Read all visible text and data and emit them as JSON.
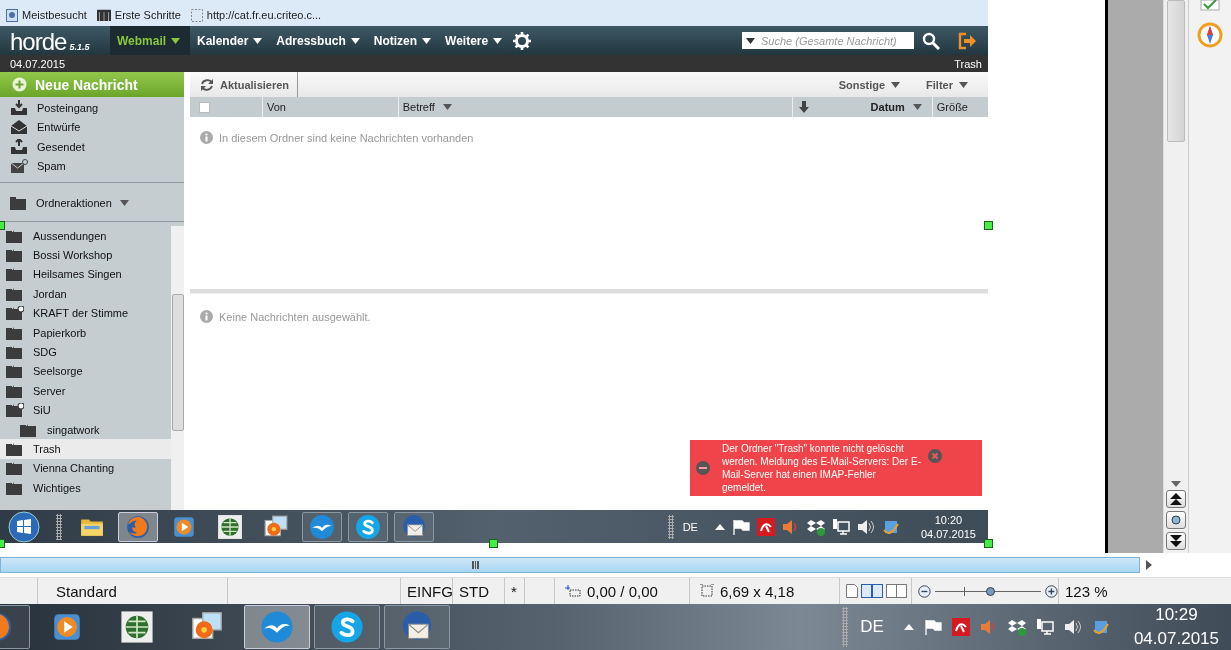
{
  "browser_bookmarks": [
    {
      "label": "Meistbesucht",
      "kind": "page"
    },
    {
      "label": "Erste Schritte",
      "kind": "m"
    },
    {
      "label": "http://cat.fr.eu.criteo.c...",
      "kind": "blank"
    }
  ],
  "app_header": {
    "logo": "horde",
    "version": "5.1.5",
    "menu": [
      {
        "label": "Webmail",
        "selected": true
      },
      {
        "label": "Kalender",
        "selected": false
      },
      {
        "label": "Adressbuch",
        "selected": false
      },
      {
        "label": "Notizen",
        "selected": false
      },
      {
        "label": "Weitere",
        "selected": false
      }
    ],
    "search": {
      "placeholder": "Suche (Gesamte Nachricht)"
    }
  },
  "date_bar": {
    "date": "04.07.2015",
    "mailbox": "Trash"
  },
  "sidebar": {
    "new_message": "Neue Nachricht",
    "mailboxes": [
      {
        "label": "Posteingang",
        "kind": "inbox"
      },
      {
        "label": "Entwürfe",
        "kind": "drafts"
      },
      {
        "label": "Gesendet",
        "kind": "sent"
      },
      {
        "label": "Spam",
        "kind": "spam"
      }
    ],
    "folder_actions": "Ordneraktionen",
    "folders": [
      {
        "label": "Aussendungen",
        "kind": "folder",
        "selected": false
      },
      {
        "label": "Bossi Workshop",
        "kind": "folder",
        "selected": false
      },
      {
        "label": "Heilsames Singen",
        "kind": "folder",
        "selected": false
      },
      {
        "label": "Jordan",
        "kind": "folder",
        "selected": false
      },
      {
        "label": "KRAFT der Stimme",
        "kind": "folder-plus",
        "selected": false
      },
      {
        "label": "Papierkorb",
        "kind": "folder",
        "selected": false
      },
      {
        "label": "SDG",
        "kind": "folder",
        "selected": false
      },
      {
        "label": "Seelsorge",
        "kind": "folder",
        "selected": false
      },
      {
        "label": "Server",
        "kind": "folder",
        "selected": false
      },
      {
        "label": "SiU",
        "kind": "folder-plus",
        "selected": false,
        "children": [
          {
            "label": "singatwork",
            "kind": "folder",
            "selected": false
          }
        ]
      },
      {
        "label": "Trash",
        "kind": "folder",
        "selected": true
      },
      {
        "label": "Vienna Chanting",
        "kind": "folder",
        "selected": false
      },
      {
        "label": "Wichtiges",
        "kind": "folder",
        "selected": false
      }
    ]
  },
  "toolbar": {
    "refresh": "Aktualisieren",
    "other": "Sonstige",
    "filter": "Filter"
  },
  "select_all": {
    "checked": false
  },
  "columns": [
    {
      "label": "Von",
      "dropdown": false,
      "sorted": false
    },
    {
      "label": "Betreff",
      "dropdown": true,
      "sorted": false
    },
    {
      "label": "Datum",
      "dropdown": true,
      "sorted": true
    },
    {
      "label": "Größe",
      "dropdown": false,
      "sorted": false
    }
  ],
  "list_message": "In diesem Ordner sind keine Nachrichten vorhanden",
  "preview_message": "Keine Nachrichten ausgewählt.",
  "error_message": "Der Ordner \"Trash\" konnte nicht gelöscht werden. Meldung des E-Mail-Servers: Der E-Mail-Server hat einen IMAP-Fehler gemeldet.",
  "inner_taskbar": {
    "apps": [
      {
        "kind": "explorer",
        "running": false,
        "selected": false
      },
      {
        "kind": "firefox",
        "running": true,
        "selected": true
      },
      {
        "kind": "media",
        "running": false,
        "selected": false
      },
      {
        "kind": "globe",
        "running": false,
        "selected": false
      },
      {
        "kind": "photos",
        "running": false,
        "selected": false
      },
      {
        "kind": "openoffice",
        "running": true,
        "selected": false
      },
      {
        "kind": "skype",
        "running": true,
        "selected": false
      },
      {
        "kind": "thunderbird",
        "running": true,
        "selected": false
      }
    ],
    "language": "DE",
    "time": "10:20",
    "date": "04.07.2015"
  },
  "status_bar": {
    "style": "Standard",
    "insert_mode": "EINFG",
    "selection_mode": "STD",
    "modified": "*",
    "position": "0,00 / 0,00",
    "size": "6,69 x 4,18",
    "zoom": {
      "level": 0.52
    },
    "zoom_text": "123 %"
  },
  "taskbar": {
    "apps": [
      {
        "kind": "firefox",
        "running": true,
        "selected": false
      },
      {
        "kind": "media",
        "running": false,
        "selected": false
      },
      {
        "kind": "globe",
        "running": false,
        "selected": false
      },
      {
        "kind": "photos",
        "running": false,
        "selected": false
      },
      {
        "kind": "openoffice",
        "running": true,
        "selected": true
      },
      {
        "kind": "skype",
        "running": true,
        "selected": false
      },
      {
        "kind": "thunderbird",
        "running": true,
        "selected": false
      }
    ],
    "language": "DE",
    "time": "10:29",
    "date": "04.07.2015"
  }
}
